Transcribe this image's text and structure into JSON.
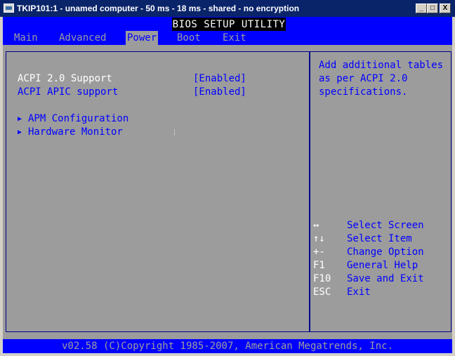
{
  "window": {
    "title": "TKIP101:1 - unamed computer - 50 ms - 18 ms - shared - no encryption",
    "buttons": {
      "minimize": "_",
      "maximize": "□",
      "close": "X"
    }
  },
  "bios": {
    "title": "BIOS SETUP UTILITY",
    "menu": [
      {
        "label": "Main",
        "active": false
      },
      {
        "label": "Advanced",
        "active": false
      },
      {
        "label": "Power",
        "active": true
      },
      {
        "label": "Boot",
        "active": false
      },
      {
        "label": "Exit",
        "active": false
      }
    ],
    "settings": [
      {
        "label": "ACPI 2.0 Support",
        "value": "[Enabled]"
      },
      {
        "label": "ACPI APIC support",
        "value": "[Enabled]"
      }
    ],
    "submenus": [
      {
        "arrow": "▶",
        "label": "APM Configuration"
      },
      {
        "arrow": "▶",
        "label": "Hardware Monitor"
      }
    ],
    "help": {
      "lines": [
        "Add additional tables",
        "as per ACPI 2.0",
        "specifications."
      ]
    },
    "keys": [
      {
        "key": "↔",
        "desc": "Select Screen"
      },
      {
        "key": "↑↓",
        "desc": "Select Item"
      },
      {
        "key": "+-",
        "desc": "Change Option"
      },
      {
        "key": "F1",
        "desc": "General Help"
      },
      {
        "key": "F10",
        "desc": "Save and Exit"
      },
      {
        "key": "ESC",
        "desc": "Exit"
      }
    ],
    "footer": "v02.58 (C)Copyright 1985-2007, American Megatrends, Inc."
  },
  "colors": {
    "bios_blue": "#0000ff",
    "bios_gray": "#9c9c9c",
    "bios_white": "#ffffff",
    "title_black": "#000000",
    "window_titlebar": "#0a246a"
  }
}
